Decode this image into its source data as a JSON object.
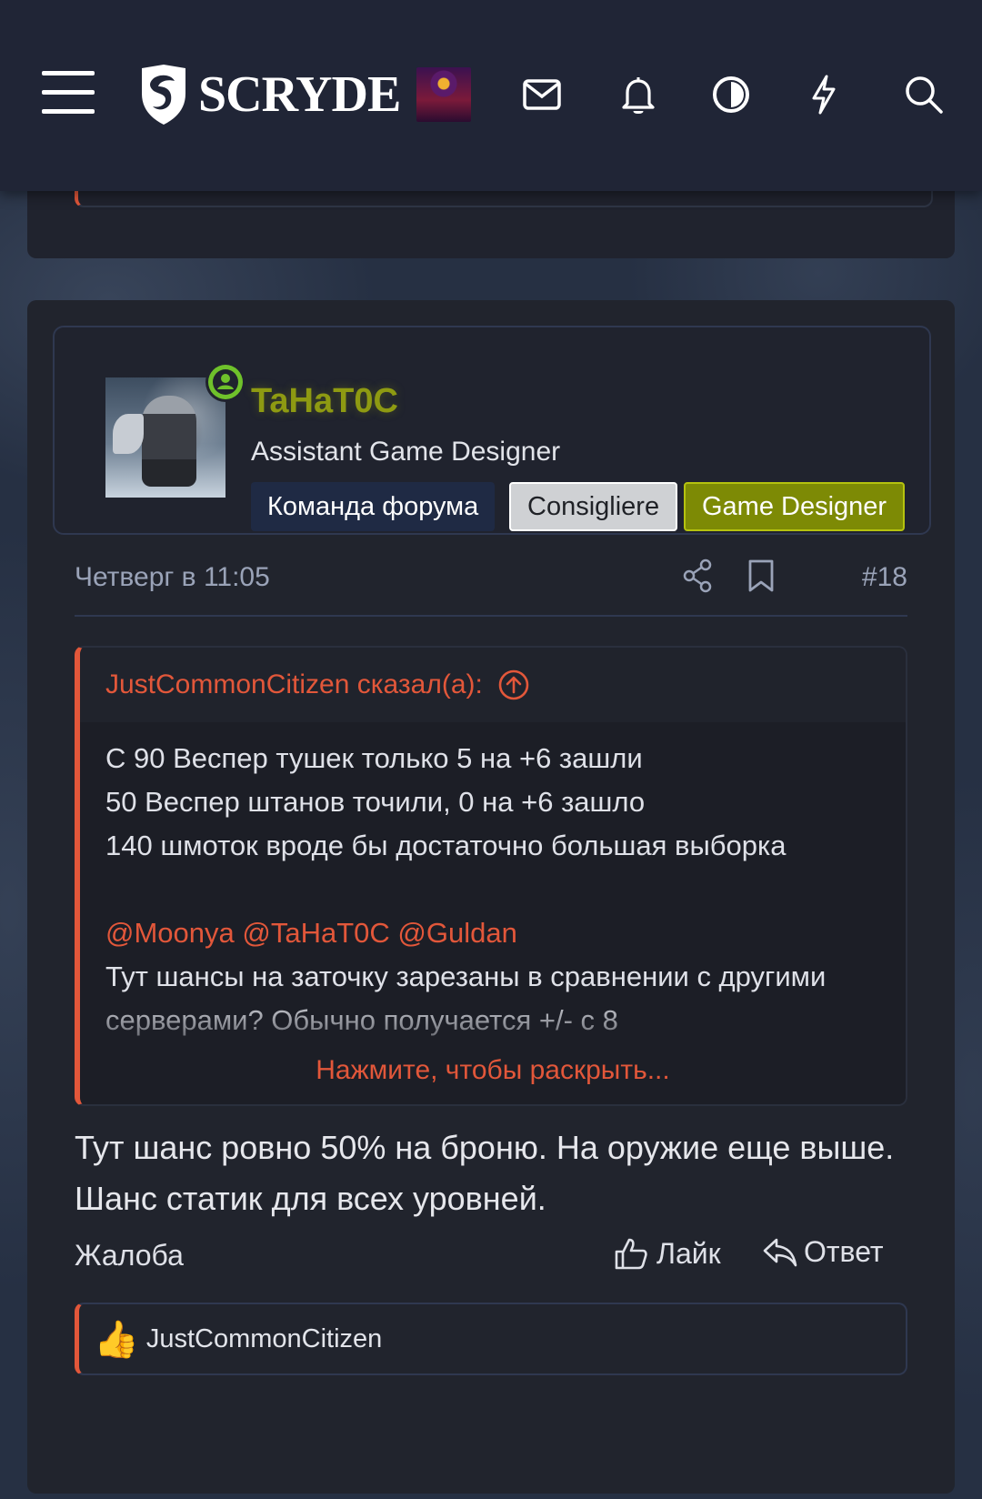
{
  "header": {
    "logo_text": "SCRYDE",
    "icons": [
      "menu-icon",
      "mail-icon",
      "bell-icon",
      "contrast-icon",
      "lightning-icon",
      "search-icon"
    ]
  },
  "post": {
    "username": "TaHaT0C",
    "user_title": "Assistant Game Designer",
    "banners": [
      "Команда форума",
      "Consigliere",
      "Game Designer"
    ],
    "date": "Четверг в 11:05",
    "number": "#18",
    "quote": {
      "author": "JustCommonCitizen сказал(а):",
      "lines": [
        "С 90 Веспер тушек только 5 на +6 зашли",
        "50 Веспер штанов точили, 0 на +6 зашло",
        "140 шмоток вроде бы достаточно большая выборка"
      ],
      "mentions": "@Moonya @TaHaT0C @Guldan",
      "after_mentions": "Тут шансы на заточку зарезаны в сравнении с другими серверами? Обычно получается +/- с 8",
      "expand_label": "Нажмите, чтобы раскрыть..."
    },
    "message": "Тут шанс ровно 50% на броню. На оружие еще выше. Шанс статик для всех уровней.",
    "actions": {
      "report": "Жалоба",
      "like": "Лайк",
      "reply": "Ответ"
    },
    "liked_by": "JustCommonCitizen"
  },
  "colors": {
    "accent": "#e2573a",
    "username": "#8e9a12",
    "header_bg": "#202536",
    "card_bg": "#21242d"
  }
}
